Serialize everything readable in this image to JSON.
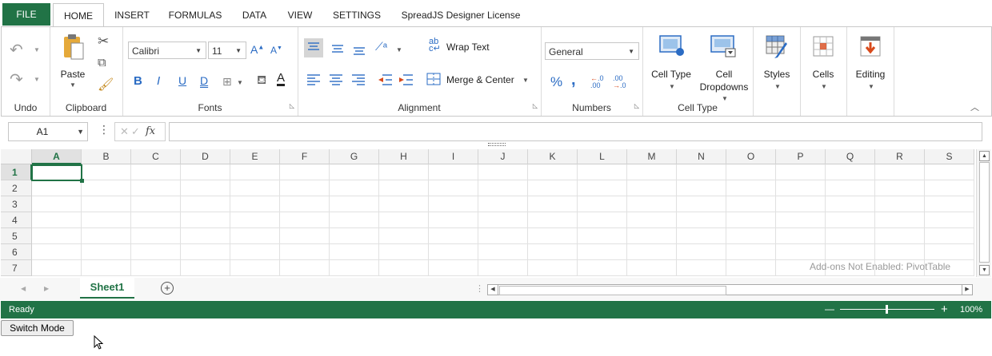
{
  "tabs": [
    "FILE",
    "HOME",
    "INSERT",
    "FORMULAS",
    "DATA",
    "VIEW",
    "SETTINGS",
    "SpreadJS Designer License"
  ],
  "groups": {
    "undo": "Undo",
    "clipboard": "Clipboard",
    "fonts": "Fonts",
    "alignment": "Alignment",
    "numbers": "Numbers",
    "cell_type": "Cell Type"
  },
  "clipboard": {
    "paste": "Paste"
  },
  "fonts": {
    "family": "Calibri",
    "size": "11",
    "bold": "B",
    "italic": "I",
    "underline": "U",
    "double_underline": "D"
  },
  "alignment": {
    "wrap_text": "Wrap Text",
    "merge_center": "Merge & Center"
  },
  "numbers": {
    "format": "General",
    "percent": "%",
    "comma": ","
  },
  "celltype": {
    "cell_type": "Cell Type",
    "cell_dropdowns_1": "Cell",
    "cell_dropdowns_2": "Dropdowns"
  },
  "styles": {
    "label": "Styles"
  },
  "cells": {
    "label": "Cells"
  },
  "editing": {
    "label": "Editing"
  },
  "formula_bar": {
    "name_box": "A1",
    "fx": "fx",
    "formula": ""
  },
  "grid": {
    "columns": [
      "A",
      "B",
      "C",
      "D",
      "E",
      "F",
      "G",
      "H",
      "I",
      "J",
      "K",
      "L",
      "M",
      "N",
      "O",
      "P",
      "Q",
      "R",
      "S"
    ],
    "rows": [
      "1",
      "2",
      "3",
      "4",
      "5",
      "6",
      "7"
    ],
    "selected_cell": "A1",
    "watermark": "Add-ons Not Enabled: PivotTable"
  },
  "sheet_tabs": [
    "Sheet1"
  ],
  "status": {
    "text": "Ready",
    "zoom": "100%",
    "zoom_minus": "—",
    "zoom_plus": "+"
  },
  "switch_mode": "Switch Mode",
  "colors": {
    "accent": "#217346",
    "selection": "#217346",
    "blue_icon": "#2b6cc4",
    "red_icon": "#d84a1b"
  }
}
